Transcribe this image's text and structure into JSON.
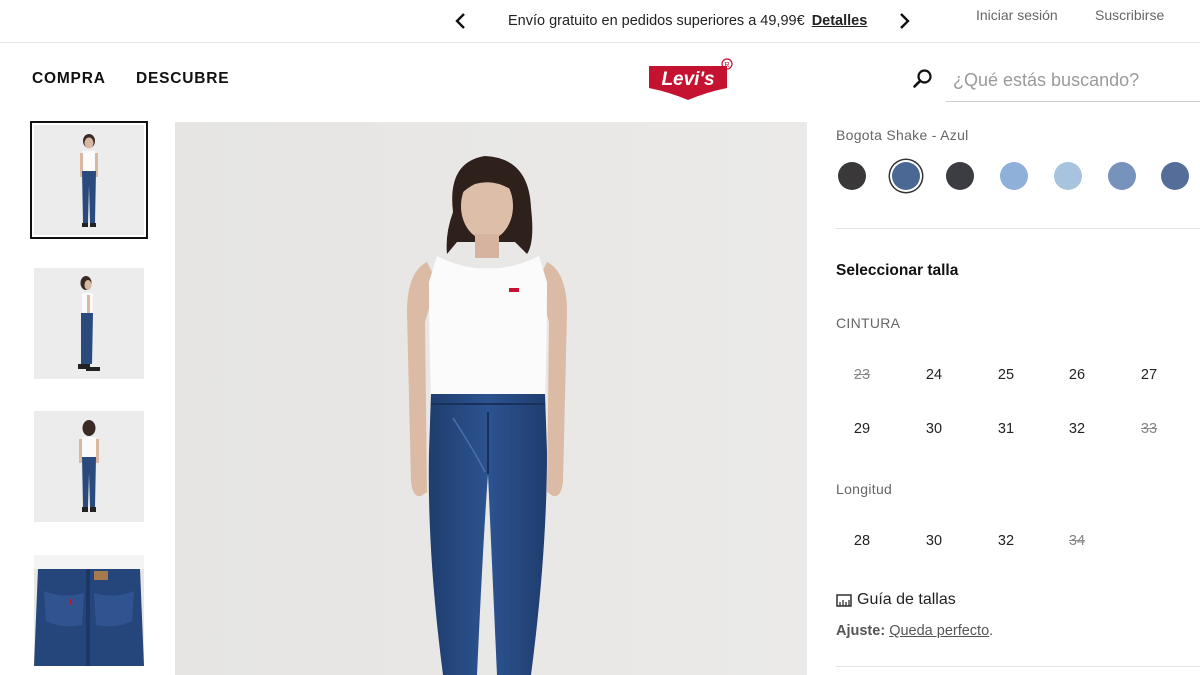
{
  "promo": {
    "text": "Envío gratuito en pedidos superiores a 49,99€",
    "link": "Detalles",
    "prev_icon": "chevron-left-icon",
    "next_icon": "chevron-right-icon"
  },
  "account": {
    "login": "Iniciar sesión",
    "subscribe": "Suscribirse"
  },
  "nav": {
    "shop": "COMPRA",
    "discover": "DESCUBRE"
  },
  "logo": {
    "text": "Levi's",
    "color": "#c41230"
  },
  "search": {
    "placeholder": "¿Qué estás buscando?",
    "icon": "search-icon"
  },
  "product": {
    "color_name": "Bogota Shake - Azul",
    "swatches": [
      {
        "color": "#3a3838",
        "selected": false
      },
      {
        "color": "#4a6893",
        "selected": true
      },
      {
        "color": "#3b3d42",
        "selected": false
      },
      {
        "color": "#8fb0d8",
        "selected": false
      },
      {
        "color": "#a7c3dd",
        "selected": false
      },
      {
        "color": "#7792bb",
        "selected": false
      },
      {
        "color": "#556e99",
        "selected": false
      }
    ],
    "size_title": "Seleccionar talla",
    "waist_label": "CINTURA",
    "waist_sizes": [
      {
        "value": "23",
        "available": false
      },
      {
        "value": "24",
        "available": true
      },
      {
        "value": "25",
        "available": true
      },
      {
        "value": "26",
        "available": true
      },
      {
        "value": "27",
        "available": true
      },
      {
        "value": "29",
        "available": true
      },
      {
        "value": "30",
        "available": true
      },
      {
        "value": "31",
        "available": true
      },
      {
        "value": "32",
        "available": true
      },
      {
        "value": "33",
        "available": false
      }
    ],
    "length_label": "Longitud",
    "length_sizes": [
      {
        "value": "28",
        "available": true
      },
      {
        "value": "30",
        "available": true
      },
      {
        "value": "32",
        "available": true
      },
      {
        "value": "34",
        "available": false
      }
    ],
    "size_guide": "Guía de tallas",
    "fit_label": "Ajuste:",
    "fit_value": "Queda perfecto",
    "fit_suffix": "."
  }
}
